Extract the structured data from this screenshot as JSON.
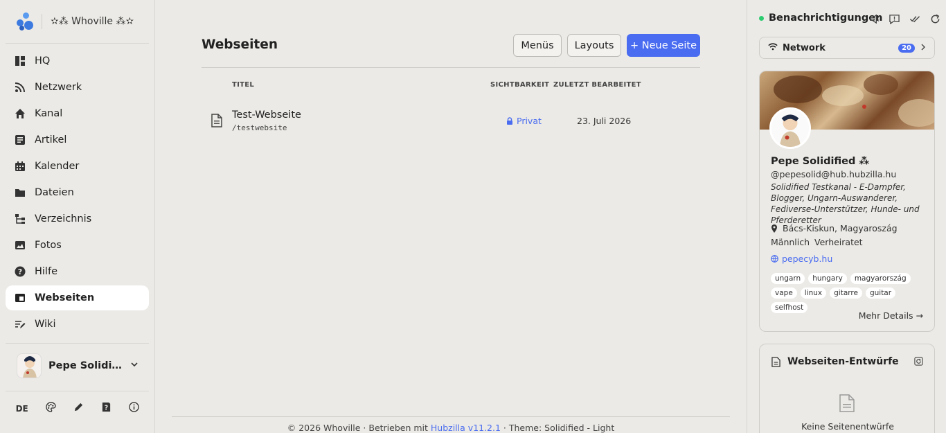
{
  "brand": {
    "name": "✫⁂ Whoville ⁂✫"
  },
  "nav": [
    {
      "label": "HQ",
      "icon": "dashboard-icon"
    },
    {
      "label": "Netzwerk",
      "icon": "rss-icon"
    },
    {
      "label": "Kanal",
      "icon": "home-icon"
    },
    {
      "label": "Artikel",
      "icon": "article-icon"
    },
    {
      "label": "Kalender",
      "icon": "calendar-icon"
    },
    {
      "label": "Dateien",
      "icon": "folder-icon"
    },
    {
      "label": "Verzeichnis",
      "icon": "sitemap-icon"
    },
    {
      "label": "Fotos",
      "icon": "image-icon"
    },
    {
      "label": "Hilfe",
      "icon": "help-icon"
    },
    {
      "label": "Webseiten",
      "icon": "webpage-icon",
      "active": true
    },
    {
      "label": "Wiki",
      "icon": "wiki-icon"
    }
  ],
  "user": {
    "name": "Pepe Solidified ⁂"
  },
  "bottom": {
    "lang": "DE"
  },
  "main": {
    "title": "Webseiten",
    "buttons": {
      "menus": "Menüs",
      "layouts": "Layouts",
      "new_page": "+ Neue Seite"
    },
    "columns": {
      "title": "TITEL",
      "visibility": "SICHTBARKEIT",
      "edited": "ZULETZT BEARBEITET"
    },
    "rows": [
      {
        "title": "Test-Webseite",
        "path": "/testwebsite",
        "visibility": "Privat",
        "edited": "23. Juli 2026"
      }
    ],
    "footer": {
      "prefix": "© 2026 Whoville · Betrieben mit ",
      "link": "Hubzilla v11.2.1",
      "suffix": " · Theme: Solidified - Light"
    }
  },
  "right": {
    "notifications_title": "Benachrichtigungen",
    "network": {
      "label": "Network",
      "count": "20"
    },
    "profile": {
      "name": "Pepe Solidified ⁂",
      "handle": "@pepesolid@hub.hubzilla.hu",
      "bio": "Solidified Testkanal - E-Dampfer, Blogger, Ungarn-Auswanderer, Fediverse-Unterstützer, Hunde- und Pferderetter",
      "location": "Bács-Kiskun, Magyaroszág",
      "gender": "Männlich",
      "marital": "Verheiratet",
      "website": "pepecyb.hu",
      "tags": [
        "ungarn",
        "hungary",
        "magyarország",
        "vape",
        "linux",
        "gitarre",
        "guitar",
        "selfhost"
      ],
      "more": "Mehr Details →"
    },
    "drafts": {
      "title": "Webseiten-Entwürfe",
      "empty": "Keine Seitenentwürfe"
    }
  },
  "colors": {
    "accent": "#4a6cf0",
    "online": "#2ecc71",
    "background": "#ebeae6"
  }
}
